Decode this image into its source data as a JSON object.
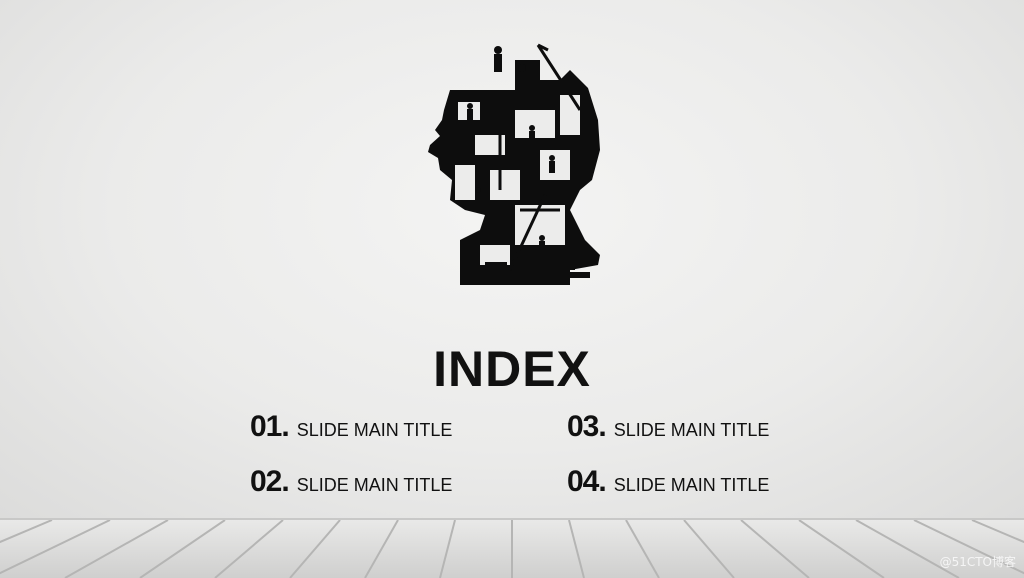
{
  "slide": {
    "title": "INDEX",
    "items": [
      {
        "number": "01.",
        "label": "SLIDE MAIN TITLE"
      },
      {
        "number": "02.",
        "label": "SLIDE MAIN TITLE"
      },
      {
        "number": "03.",
        "label": "SLIDE MAIN TITLE"
      },
      {
        "number": "04.",
        "label": "SLIDE MAIN TITLE"
      }
    ]
  },
  "watermark": "@51CTO博客",
  "colors": {
    "ink": "#111111",
    "wall": "#eeeeed",
    "floor": "#d9d9d8"
  },
  "graphic": "head-silhouette-with-construction-workers-and-cranes"
}
